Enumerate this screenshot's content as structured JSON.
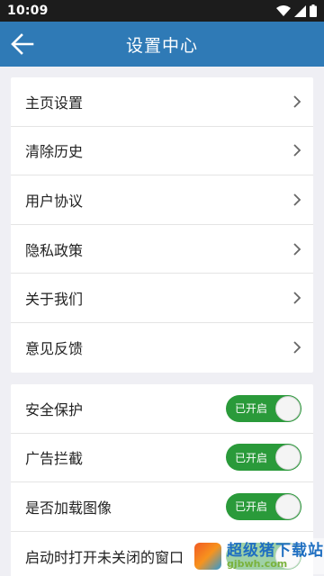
{
  "status_bar": {
    "time": "10:09"
  },
  "app_bar": {
    "title": "设置中心",
    "back_icon": "arrow-left-icon"
  },
  "colors": {
    "primary": "#2f7ab6",
    "toggle_on": "#2a9a3a",
    "background": "#efeff4"
  },
  "nav_items": [
    {
      "label": "主页设置",
      "icon": "chevron-right-icon"
    },
    {
      "label": "清除历史",
      "icon": "chevron-right-icon"
    },
    {
      "label": "用户协议",
      "icon": "chevron-right-icon"
    },
    {
      "label": "隐私政策",
      "icon": "chevron-right-icon"
    },
    {
      "label": "关于我们",
      "icon": "chevron-right-icon"
    },
    {
      "label": "意见反馈",
      "icon": "chevron-right-icon"
    }
  ],
  "toggle_items": [
    {
      "label": "安全保护",
      "state": "已开启",
      "on": true
    },
    {
      "label": "广告拦截",
      "state": "已开启",
      "on": true
    },
    {
      "label": "是否加载图像",
      "state": "已开启",
      "on": true
    },
    {
      "label": "启动时打开未关闭的窗口",
      "state": "",
      "on": true
    }
  ],
  "watermark": {
    "title": "超级猪下载站",
    "url": "gjbwh.com"
  }
}
